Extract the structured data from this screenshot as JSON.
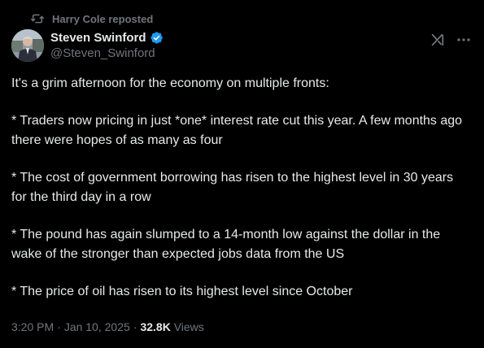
{
  "repost": {
    "icon": "repost-icon",
    "text": "Harry Cole reposted"
  },
  "author": {
    "display_name": "Steven Swinford",
    "handle": "@Steven_Swinford",
    "verified": true,
    "verified_color": "#1d9bf0"
  },
  "actions": {
    "grok_icon": "grok-icon",
    "more_icon": "more-icon"
  },
  "tweet": {
    "paragraphs": [
      "It's a grim afternoon for the economy on multiple fronts:",
      "* Traders now pricing in just *one* interest rate cut this year. A few months ago there were hopes of as  many as four",
      "* The cost of government borrowing has risen to the highest level in 30 years for the third day in a row",
      "* The pound has again slumped to a 14-month low against the dollar in the wake of the stronger than expected jobs data from the US",
      "* The price of oil has risen to its highest level since October"
    ]
  },
  "meta": {
    "time": "3:20 PM",
    "date": "Jan 10, 2025",
    "separator": "·",
    "views_count": "32.8K",
    "views_label": "Views"
  },
  "colors": {
    "background": "#000000",
    "text_primary": "#e7e9ea",
    "text_secondary": "#71767b"
  }
}
